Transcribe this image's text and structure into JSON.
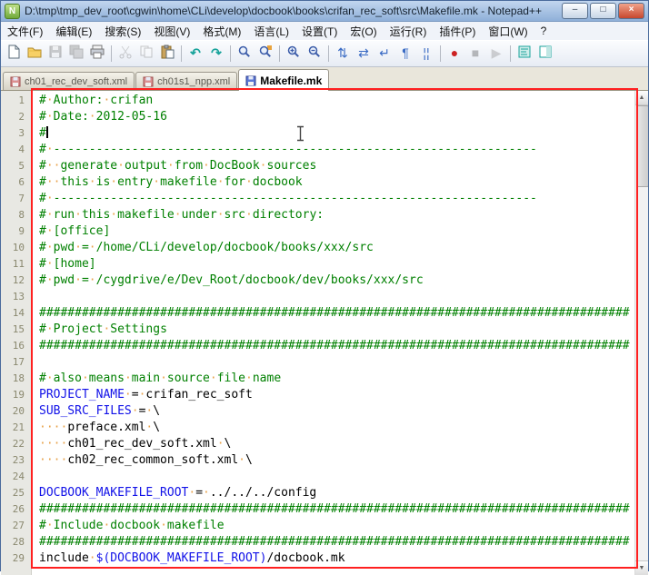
{
  "window": {
    "title": "D:\\tmp\\tmp_dev_root\\cgwin\\home\\CLi\\develop\\docbook\\books\\crifan_rec_soft\\src\\Makefile.mk - Notepad++",
    "app_icon": "N",
    "controls": [
      {
        "name": "minimize",
        "glyph": "–"
      },
      {
        "name": "maximize",
        "glyph": "□"
      },
      {
        "name": "close",
        "glyph": "×"
      }
    ]
  },
  "menu": {
    "items": [
      "文件(F)",
      "编辑(E)",
      "搜索(S)",
      "视图(V)",
      "格式(M)",
      "语言(L)",
      "设置(T)",
      "宏(O)",
      "运行(R)",
      "插件(P)",
      "窗口(W)",
      "?"
    ]
  },
  "toolbar": {
    "buttons": [
      {
        "name": "new-file",
        "enabled": true
      },
      {
        "name": "open-folder",
        "enabled": true
      },
      {
        "name": "save-file",
        "enabled": false
      },
      {
        "name": "save-all",
        "enabled": false
      },
      {
        "name": "print",
        "enabled": true
      },
      {
        "name": "separator"
      },
      {
        "name": "cut",
        "enabled": false
      },
      {
        "name": "copy",
        "enabled": false
      },
      {
        "name": "paste",
        "enabled": true
      },
      {
        "name": "separator"
      },
      {
        "name": "undo",
        "enabled": true
      },
      {
        "name": "redo",
        "enabled": true
      },
      {
        "name": "separator"
      },
      {
        "name": "find",
        "enabled": true
      },
      {
        "name": "replace",
        "enabled": true
      },
      {
        "name": "separator"
      },
      {
        "name": "zoom-in",
        "enabled": true
      },
      {
        "name": "zoom-out",
        "enabled": true
      },
      {
        "name": "separator"
      },
      {
        "name": "sync-vertical",
        "enabled": true
      },
      {
        "name": "sync-horizontal",
        "enabled": true
      },
      {
        "name": "word-wrap",
        "enabled": true
      },
      {
        "name": "show-all-chars",
        "enabled": true
      },
      {
        "name": "indent-guide",
        "enabled": true
      },
      {
        "name": "separator"
      },
      {
        "name": "record-macro",
        "enabled": true
      },
      {
        "name": "stop-macro",
        "enabled": false
      },
      {
        "name": "play-macro",
        "enabled": false
      },
      {
        "name": "separator"
      },
      {
        "name": "function-list",
        "enabled": true
      },
      {
        "name": "doc-map",
        "enabled": true
      }
    ]
  },
  "tabs": [
    {
      "label": "ch01_rec_dev_soft.xml",
      "active": false,
      "state": "modified",
      "icon": "floppy-icon"
    },
    {
      "label": "ch01s1_npp.xml",
      "active": false,
      "state": "modified",
      "icon": "floppy-icon"
    },
    {
      "label": "Makefile.mk",
      "active": true,
      "state": "saved",
      "icon": "floppy-icon"
    }
  ],
  "editor": {
    "language": "makefile",
    "lines": [
      {
        "n": 1,
        "segs": [
          [
            "c",
            "# Author: crifan"
          ]
        ]
      },
      {
        "n": 2,
        "segs": [
          [
            "c",
            "# Date: 2012-05-16"
          ]
        ]
      },
      {
        "n": 3,
        "segs": [
          [
            "c",
            "#"
          ]
        ],
        "caret": true
      },
      {
        "n": 4,
        "segs": [
          [
            "c",
            "# --------------------------------------------------------------------"
          ]
        ]
      },
      {
        "n": 5,
        "segs": [
          [
            "c",
            "#  generate output from DocBook sources"
          ]
        ]
      },
      {
        "n": 6,
        "segs": [
          [
            "c",
            "#  this is entry makefile for docbook"
          ]
        ]
      },
      {
        "n": 7,
        "segs": [
          [
            "c",
            "# --------------------------------------------------------------------"
          ]
        ]
      },
      {
        "n": 8,
        "segs": [
          [
            "c",
            "# run this makefile under src directory:"
          ]
        ]
      },
      {
        "n": 9,
        "segs": [
          [
            "c",
            "# [office]"
          ]
        ]
      },
      {
        "n": 10,
        "segs": [
          [
            "c",
            "# pwd = /home/CLi/develop/docbook/books/xxx/src"
          ]
        ]
      },
      {
        "n": 11,
        "segs": [
          [
            "c",
            "# [home]"
          ]
        ]
      },
      {
        "n": 12,
        "segs": [
          [
            "c",
            "# pwd = /cygdrive/e/Dev_Root/docbook/dev/books/xxx/src"
          ]
        ]
      },
      {
        "n": 13,
        "segs": []
      },
      {
        "n": 14,
        "segs": [
          [
            "c",
            "###################################################################################"
          ]
        ]
      },
      {
        "n": 15,
        "segs": [
          [
            "c",
            "# Project Settings"
          ]
        ]
      },
      {
        "n": 16,
        "segs": [
          [
            "c",
            "###################################################################################"
          ]
        ]
      },
      {
        "n": 17,
        "segs": []
      },
      {
        "n": 18,
        "segs": [
          [
            "c",
            "# also means main source file name"
          ]
        ]
      },
      {
        "n": 19,
        "segs": [
          [
            "v",
            "PROJECT_NAME"
          ],
          [
            "t",
            " = crifan_rec_soft"
          ]
        ]
      },
      {
        "n": 20,
        "segs": [
          [
            "v",
            "SUB_SRC_FILES"
          ],
          [
            "t",
            " = \\"
          ]
        ]
      },
      {
        "n": 21,
        "segs": [
          [
            "t",
            "    preface.xml \\"
          ]
        ]
      },
      {
        "n": 22,
        "segs": [
          [
            "t",
            "    ch01_rec_dev_soft.xml \\"
          ]
        ]
      },
      {
        "n": 23,
        "segs": [
          [
            "t",
            "    ch02_rec_common_soft.xml \\"
          ]
        ]
      },
      {
        "n": 24,
        "segs": []
      },
      {
        "n": 25,
        "segs": [
          [
            "v",
            "DOCBOOK_MAKEFILE_ROOT"
          ],
          [
            "t",
            " = ../../../config"
          ]
        ]
      },
      {
        "n": 26,
        "segs": [
          [
            "c",
            "###################################################################################"
          ]
        ]
      },
      {
        "n": 27,
        "segs": [
          [
            "c",
            "# Include docbook makefile"
          ]
        ]
      },
      {
        "n": 28,
        "segs": [
          [
            "c",
            "###################################################################################"
          ]
        ]
      },
      {
        "n": 29,
        "segs": [
          [
            "t",
            "include "
          ],
          [
            "v",
            "$(DOCBOOK_MAKEFILE_ROOT)"
          ],
          [
            "t",
            "/docbook.mk"
          ]
        ]
      }
    ]
  },
  "scrollbar": {
    "up_glyph": "▲",
    "down_glyph": "▼"
  },
  "colors": {
    "comment": "#008000",
    "variable": "#1212E8",
    "default_text": "#000000",
    "whitespace_dot": "#E8A24A",
    "annotation_red": "#FF2020",
    "titlebar_blue": "#9CB9E0"
  }
}
